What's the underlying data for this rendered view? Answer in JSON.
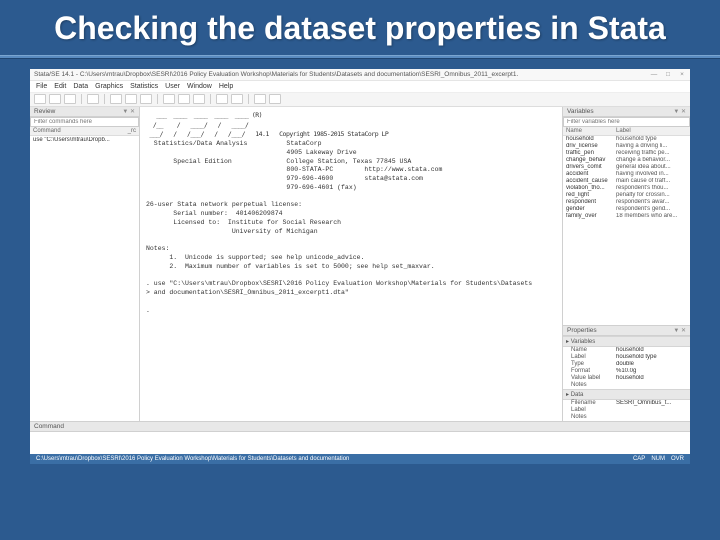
{
  "slide": {
    "title": "Checking the dataset properties in Stata"
  },
  "window": {
    "title": "Stata/SE 14.1 - C:\\Users\\mtrau\\Dropbox\\SESRI\\2016 Policy Evaluation Workshop\\Materials for Students\\Datasets and documentation\\SESRI_Omnibus_2011_excerpt1.",
    "sys_min": "—",
    "sys_max": "□",
    "sys_close": "×"
  },
  "menu": [
    "File",
    "Edit",
    "Data",
    "Graphics",
    "Statistics",
    "User",
    "Window",
    "Help"
  ],
  "review": {
    "title": "Review",
    "filter_placeholder": "Filter commands here",
    "col1": "Command",
    "col2": "_rc",
    "rows": [
      {
        "cmd": "use \"C:\\Users\\mtrau\\Dropb...",
        "rc": ""
      }
    ]
  },
  "results": {
    "logo1": "   ___  ____  ____  ____  ____ (R)",
    "logo2": "  /__    /   ____/   /   ____/",
    "logo3": " ___/   /   /___/   /   /___/   14.1   Copyright 1985-2015 StataCorp LP",
    "logo4": "  Statistics/Data Analysis          StataCorp",
    "addr1": "                                    4905 Lakeway Drive",
    "edition": "       Special Edition              College Station, Texas 77845 USA",
    "phone": "                                    800-STATA-PC        http://www.stata.com",
    "fax": "                                    979-696-4600        stata@stata.com",
    "fax2": "                                    979-696-4601 (fax)",
    "blank": "",
    "lic1": "26-user Stata network perpetual license:",
    "lic2": "       Serial number:  401406209874",
    "lic3": "       Licensed to:  Institute for Social Research",
    "lic4": "                      University of Michigan",
    "notes_hdr": "Notes:",
    "note1": "      1.  Unicode is supported; see help unicode_advice.",
    "note2": "      2.  Maximum number of variables is set to 5000; see help set_maxvar.",
    "cmd1a": ". use \"C:\\Users\\mtrau\\Dropbox\\SESRI\\2016 Policy Evaluation Workshop\\Materials for Students\\Datasets",
    "cmd1b": "> and documentation\\SESRI_Omnibus_2011_excerpt1.dta\"",
    "cmd2": ". "
  },
  "variables": {
    "title": "Variables",
    "filter_placeholder": "Filter variables here",
    "col1": "Name",
    "col2": "Label",
    "rows": [
      {
        "name": "household",
        "label": "household type"
      },
      {
        "name": "driv_license",
        "label": "having a driving li..."
      },
      {
        "name": "traffic_pen",
        "label": "receiving traffic pe..."
      },
      {
        "name": "change_behav",
        "label": "change a behavior..."
      },
      {
        "name": "drivers_comit",
        "label": "general idea about..."
      },
      {
        "name": "accident",
        "label": "having involved in..."
      },
      {
        "name": "accident_cause",
        "label": "main cause of traff..."
      },
      {
        "name": "violation_tho...",
        "label": "respondent's thou..."
      },
      {
        "name": "red_light",
        "label": "penalty for crossin..."
      },
      {
        "name": "respondent",
        "label": "respondent's awar..."
      },
      {
        "name": "gender",
        "label": "respondent's gend..."
      },
      {
        "name": "family_over",
        "label": "18 members who are..."
      }
    ]
  },
  "properties": {
    "title": "Properties",
    "sec_vars": "Variables",
    "var_rows": [
      {
        "k": "Name",
        "v": "household"
      },
      {
        "k": "Label",
        "v": "household type"
      },
      {
        "k": "Type",
        "v": "double"
      },
      {
        "k": "Format",
        "v": "%10.0g"
      },
      {
        "k": "Value label",
        "v": "household"
      },
      {
        "k": "Notes",
        "v": ""
      }
    ],
    "sec_data": "Data",
    "data_rows": [
      {
        "k": "Filename",
        "v": "SESRI_Omnibus_t..."
      },
      {
        "k": "Label",
        "v": ""
      },
      {
        "k": "Notes",
        "v": ""
      }
    ]
  },
  "command": {
    "title": "Command"
  },
  "statusbar": {
    "path": "C:\\Users\\mtrau\\Dropbox\\SESRI\\2016 Policy Evaluation Workshop\\Materials for Students\\Datasets and documentation",
    "ind1": "CAP",
    "ind2": "NUM",
    "ind3": "OVR"
  }
}
